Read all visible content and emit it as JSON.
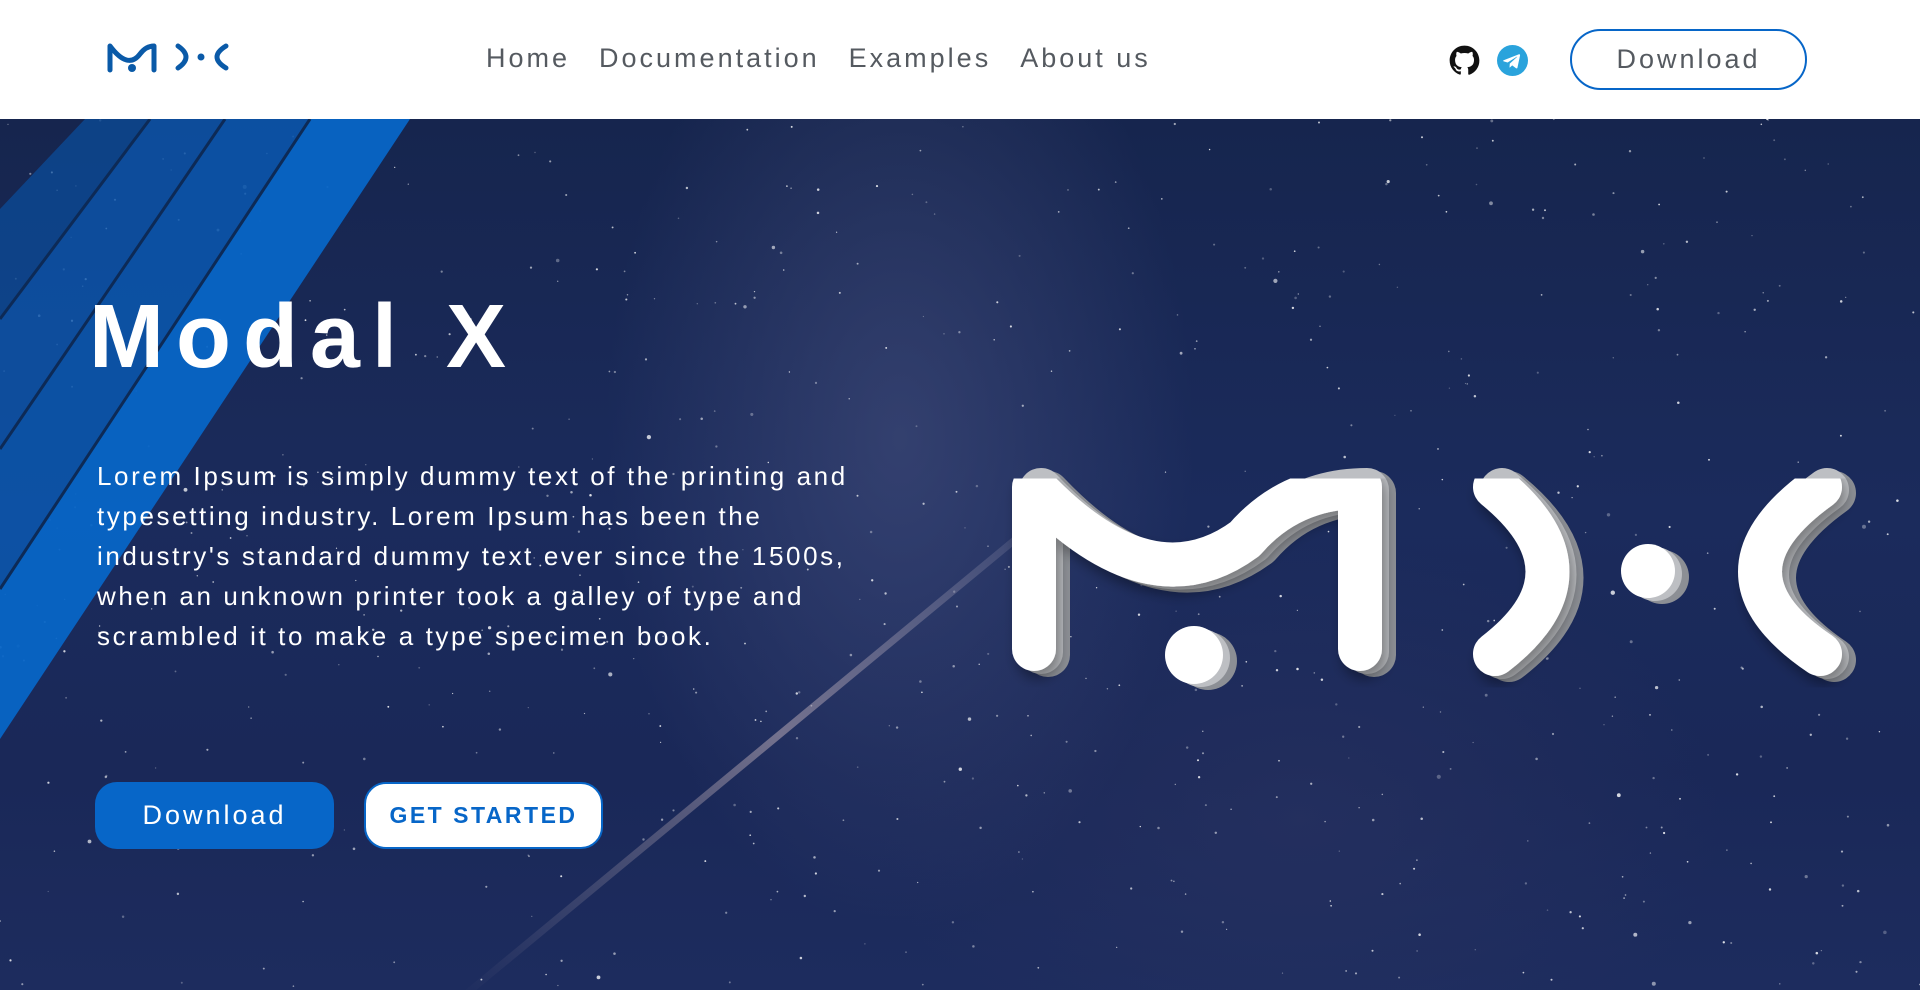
{
  "header": {
    "logo_icon": "mdx-logo-icon",
    "nav": [
      {
        "label": "Home"
      },
      {
        "label": "Documentation"
      },
      {
        "label": "Examples"
      },
      {
        "label": "About us"
      }
    ],
    "social": [
      {
        "icon": "github-icon"
      },
      {
        "icon": "telegram-icon"
      }
    ],
    "download_label": "Download"
  },
  "hero": {
    "title": "Modal X",
    "description": "Lorem Ipsum is simply dummy text of the printing and typesetting industry. Lorem Ipsum has been the industry's standard dummy text ever since the 1500s, when an unknown printer took a galley of type and scrambled it to make a type specimen book.",
    "download_label": "Download",
    "get_started_label": "GET STARTED",
    "logo_icon": "mdx-large-logo-icon"
  },
  "colors": {
    "accent": "#0766c8",
    "nav_text": "#555a60",
    "hero_bg": "#1b2b5c",
    "telegram": "#2aa3dc"
  }
}
